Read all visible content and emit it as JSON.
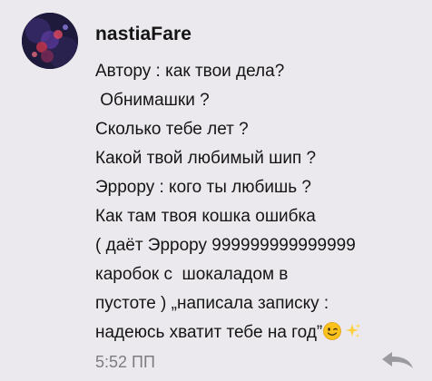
{
  "comment": {
    "username": "nastiaFare",
    "avatar_icon": "user-avatar-icon",
    "message_lines": [
      "Автору : как твои дела?",
      " Обнимашки ?",
      "Сколько тебе лет ?",
      "Какой твой любимый шип ?",
      "Эррору : кого ты любишь ?",
      "Как там твоя кошка ошибка",
      "( даёт Эррору 999999999999999",
      "каробок с  шокаладом в",
      "пустоте ) „написала записку :",
      "надеюсь хватит тебе на год”"
    ],
    "emojis": [
      "winking-face-emoji",
      "sparkles-emoji"
    ],
    "timestamp": "5:52 ПП",
    "reply_icon": "reply-arrow-icon"
  }
}
